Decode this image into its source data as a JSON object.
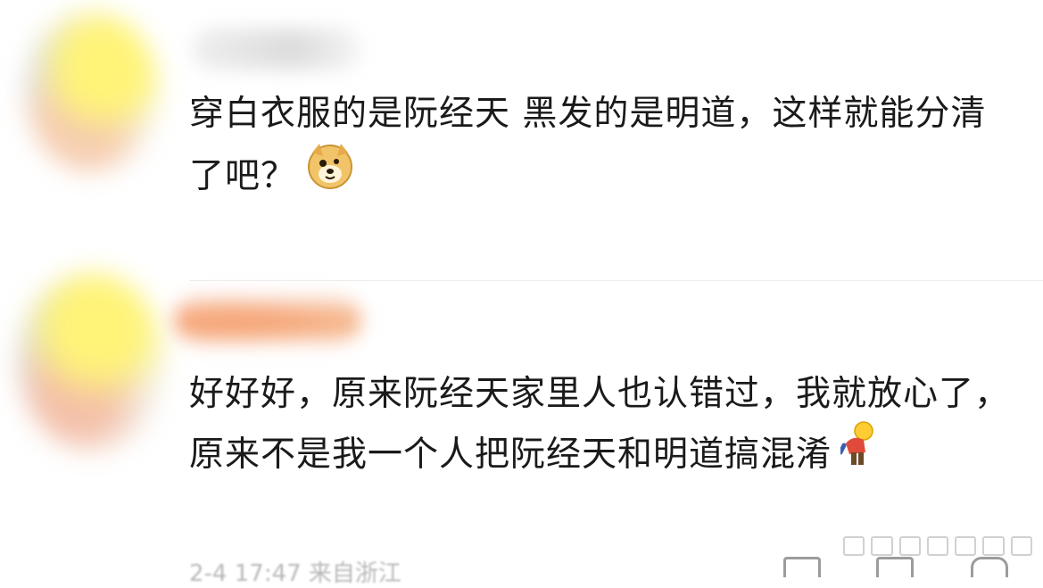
{
  "comments": [
    {
      "text": "穿白衣服的是阮经天 黑发的是明道，这样就能分清了吧？",
      "emoji": "doge-emoji-icon"
    },
    {
      "text": "好好好，原来阮经天家里人也认错过，我就放心了，原来不是我一个人把阮经天和明道搞混淆",
      "emoji": "bowing-person-emoji-icon"
    }
  ],
  "footer": {
    "meta_text": "2-4 17:47 来自浙江"
  }
}
